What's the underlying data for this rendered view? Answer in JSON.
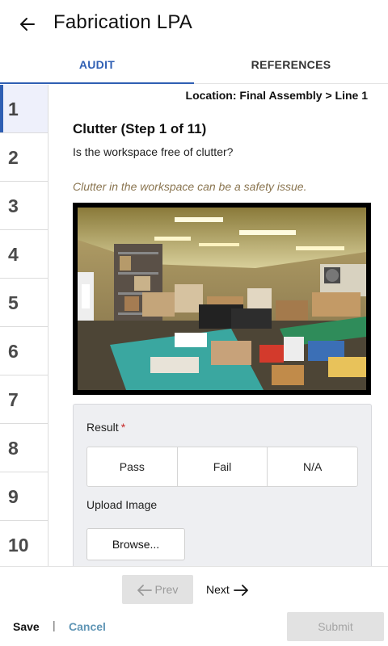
{
  "header": {
    "title": "Fabrication LPA",
    "back_icon": "arrow-left-icon"
  },
  "tabs": [
    {
      "label": "AUDIT",
      "active": true
    },
    {
      "label": "REFERENCES",
      "active": false
    }
  ],
  "steps": [
    "1",
    "2",
    "3",
    "4",
    "5",
    "6",
    "7",
    "8",
    "9",
    "10"
  ],
  "active_step": "1",
  "main": {
    "location": "Location: Final Assembly > Line 1",
    "step_title": "Clutter  (Step 1 of 11)",
    "question": "Is the workspace free of clutter?",
    "hint": "Clutter in the workspace can be a safety issue.",
    "photo_icon": "cluttered-workspace-photo"
  },
  "result": {
    "label": "Result",
    "required_mark": "*",
    "options": [
      "Pass",
      "Fail",
      "N/A"
    ],
    "upload_label": "Upload Image",
    "browse_label": "Browse..."
  },
  "footer": {
    "prev_label": "Prev",
    "next_label": "Next",
    "save_label": "Save",
    "separator": "|",
    "cancel_label": "Cancel",
    "submit_label": "Submit"
  },
  "colors": {
    "accent": "#2f5fb3",
    "hint": "#8a7550",
    "cancel": "#5f95b5",
    "required": "#c62828",
    "disabled_bg": "#e2e2e2"
  }
}
